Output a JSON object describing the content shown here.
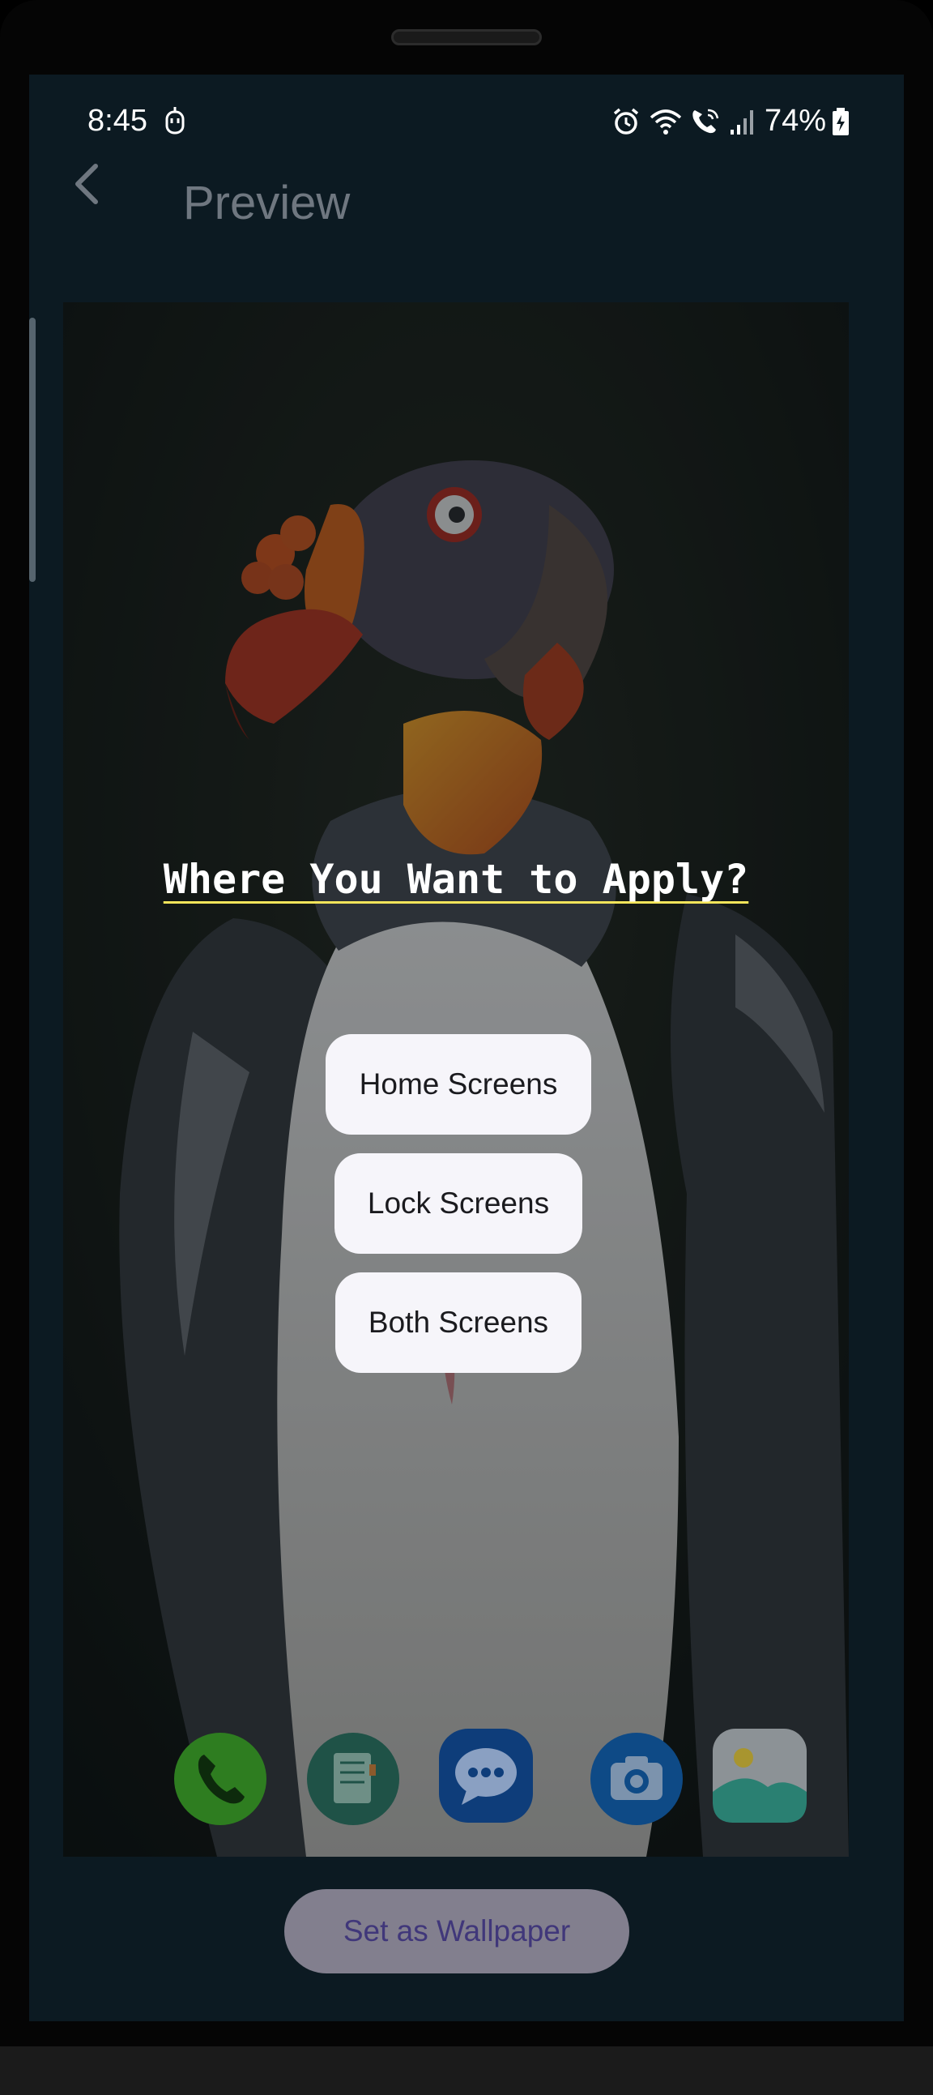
{
  "status_bar": {
    "time": "8:45",
    "battery": "74%",
    "icons": [
      "assistant-icon",
      "alarm-icon",
      "wifi-icon",
      "wifi-calling-icon",
      "signal-icon",
      "battery-charging-icon"
    ]
  },
  "app_bar": {
    "back_icon": "chevron-left-icon",
    "title": "Preview"
  },
  "dialog": {
    "heading": "Where You Want to Apply?",
    "options": [
      {
        "label": "Home Screens"
      },
      {
        "label": "Lock Screens"
      },
      {
        "label": "Both Screens"
      }
    ]
  },
  "dock": {
    "icons": [
      "phone-icon",
      "contacts-icon",
      "messages-icon",
      "camera-icon",
      "gallery-icon"
    ]
  },
  "actions": {
    "set_wallpaper": "Set as Wallpaper"
  },
  "colors": {
    "screen_bg": "#0c1a22",
    "button_bg": "#f6f5fa",
    "heading_underline": "#f5e55a",
    "primary_button_bg": "#827f8e",
    "primary_button_text": "#40377a"
  }
}
